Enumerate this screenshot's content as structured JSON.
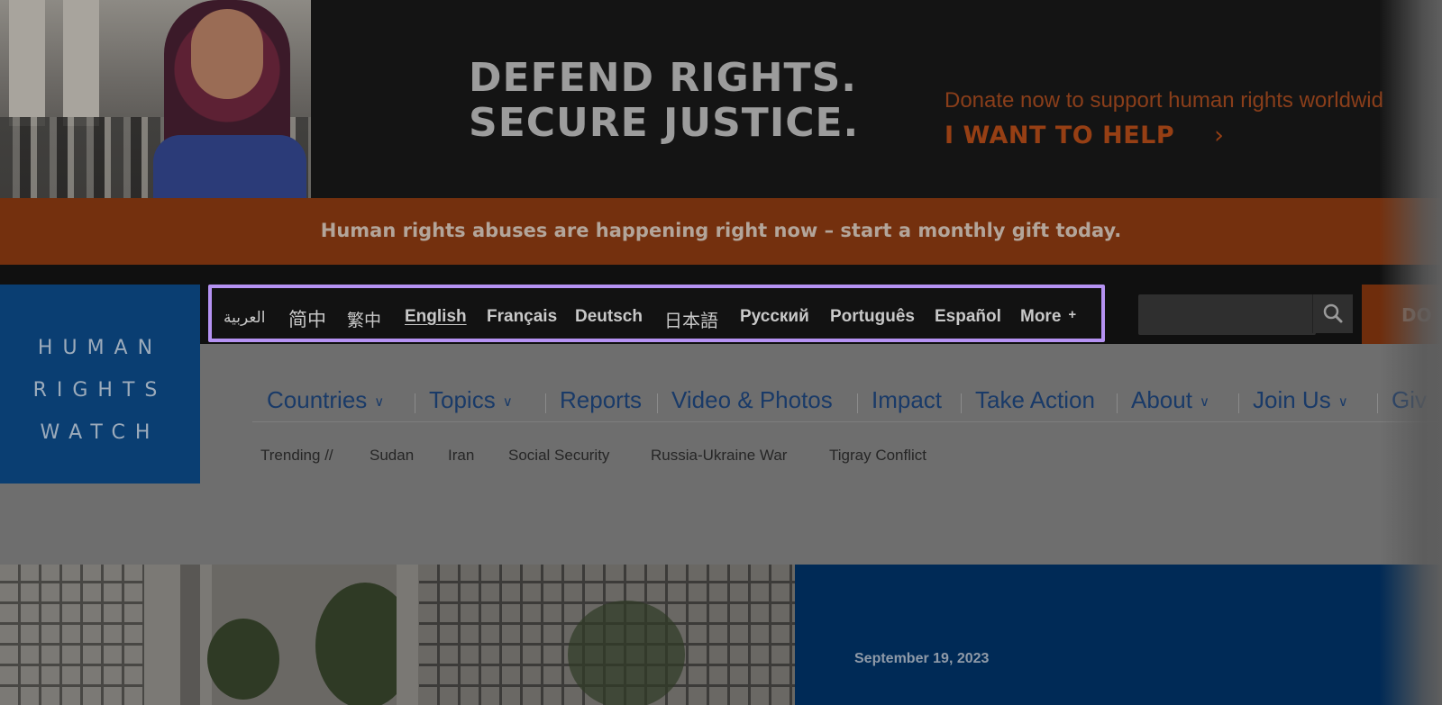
{
  "hero": {
    "headline_line1": "DEFEND RIGHTS.",
    "headline_line2": "SECURE JUSTICE.",
    "donate_text": "Donate now to support human rights worldwid",
    "cta_label": "I WANT TO HELP",
    "cta_chevron": "›"
  },
  "gift_strip": {
    "text": "Human rights abuses are happening right now – start a monthly gift today."
  },
  "logo": {
    "line1": "HUMAN",
    "line2": "RIGHTS",
    "line3": "WATCH"
  },
  "languages": [
    {
      "label": "العربية"
    },
    {
      "label": "简中"
    },
    {
      "label": "繁中"
    },
    {
      "label": "English"
    },
    {
      "label": "Français"
    },
    {
      "label": "Deutsch"
    },
    {
      "label": "日本語"
    },
    {
      "label": "Русский"
    },
    {
      "label": "Português"
    },
    {
      "label": "Español"
    },
    {
      "label": "More",
      "suffix": "+"
    }
  ],
  "active_language": "English",
  "highlight_color": "#b592f2",
  "topbar_cut_label": "DO",
  "nav": [
    {
      "label": "Countries",
      "caret": "∨"
    },
    {
      "label": "Topics",
      "caret": "∨"
    },
    {
      "label": "Reports"
    },
    {
      "label": "Video & Photos"
    },
    {
      "label": "Impact"
    },
    {
      "label": "Take Action"
    },
    {
      "label": "About",
      "caret": "∨"
    },
    {
      "label": "Join Us",
      "caret": "∨"
    },
    {
      "label": "Giv"
    }
  ],
  "trending": {
    "label": "Trending //",
    "items": [
      "Sudan",
      "Iran",
      "Social Security",
      "Russia-Ukraine War",
      "Tigray Conflict"
    ]
  },
  "feature": {
    "date": "September 19, 2023"
  },
  "colors": {
    "brand_blue": "#0a3e72",
    "brand_orange": "#74300e",
    "nav_text": "#193a68"
  }
}
